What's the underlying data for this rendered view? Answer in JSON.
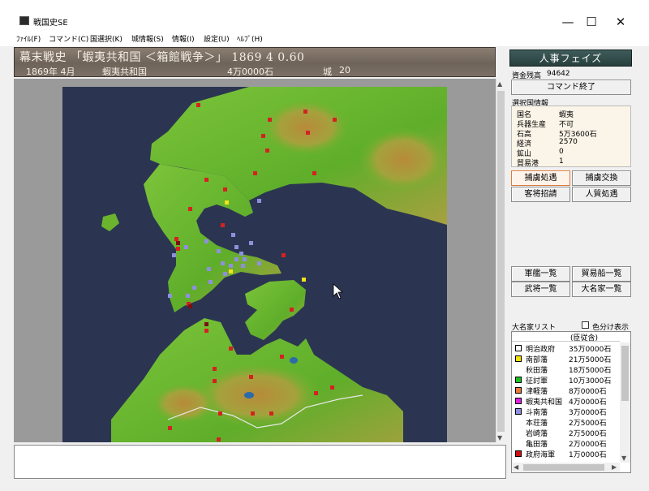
{
  "window": {
    "title": "戦国史SE",
    "minimize": "—",
    "maximize": "☐",
    "close": "✕"
  },
  "menu": [
    "ﾌｧｲﾙ(F)",
    "コマンド(C)",
    "国選択(K)",
    "城情報(S)",
    "情報(I)",
    "設定(U)",
    "ﾍﾙﾌﾟ(H)"
  ],
  "banner": {
    "line1": "幕末戦史 「蝦夷共和国 ＜箱館戦争＞」 1869 4 0.60",
    "date": "1869年 4月",
    "country": "蝦夷共和国",
    "koku": "4万0000石",
    "castle_label": "城",
    "castle_count": "20"
  },
  "right_panel": {
    "phase": "人事フェイズ",
    "funds_label": "資金残高",
    "funds_value": "94642",
    "end_command": "コマンド終了",
    "selected_info_label": "選択国情報",
    "country_info": [
      {
        "k": "国名",
        "v": "蝦夷"
      },
      {
        "k": "兵器生産",
        "v": "不可"
      },
      {
        "k": "石高",
        "v": "5万3600石"
      },
      {
        "k": "経済",
        "v": "2570"
      },
      {
        "k": "鉱山",
        "v": "0"
      },
      {
        "k": "貿易港",
        "v": "1"
      }
    ],
    "action_buttons": [
      "捕虜処遇",
      "捕虜交換",
      "客将招請",
      "人質処遇"
    ],
    "list_buttons": [
      "軍艦一覧",
      "貿易船一覧",
      "武将一覧",
      "大名家一覧"
    ],
    "daimyo_list_label": "大名家リスト",
    "color_toggle_label": "色分け表示",
    "list_header": "(臣従含)",
    "daimyo": [
      {
        "name": "明治政府",
        "koku": "35万0000石",
        "color": "#ffffff"
      },
      {
        "name": "南部藩",
        "koku": "21万5000石",
        "color": "#f6e400"
      },
      {
        "name": "秋田藩",
        "koku": "18万5000石",
        "color": ""
      },
      {
        "name": "征討軍",
        "koku": "10万3000石",
        "color": "#1cc21c"
      },
      {
        "name": "津軽藩",
        "koku": "8万0000石",
        "color": "#ef7a34"
      },
      {
        "name": "蝦夷共和国",
        "koku": "4万0000石",
        "color": "#e21ce2"
      },
      {
        "name": "斗南藩",
        "koku": "3万0000石",
        "color": "#8e8ee6"
      },
      {
        "name": "本荘藩",
        "koku": "2万5000石",
        "color": ""
      },
      {
        "name": "岩崎藩",
        "koku": "2万5000石",
        "color": ""
      },
      {
        "name": "亀田藩",
        "koku": "2万0000石",
        "color": ""
      },
      {
        "name": "政府海軍",
        "koku": "1万0000石",
        "color": "#d01010"
      }
    ]
  },
  "map": {
    "sea_color": "#2b3552",
    "land_color": "#6cb42e",
    "markers": {
      "red": "#d42222",
      "blue": "#8f8fe0",
      "yellow": "#f4e21a",
      "darkred": "#7a1010"
    }
  }
}
